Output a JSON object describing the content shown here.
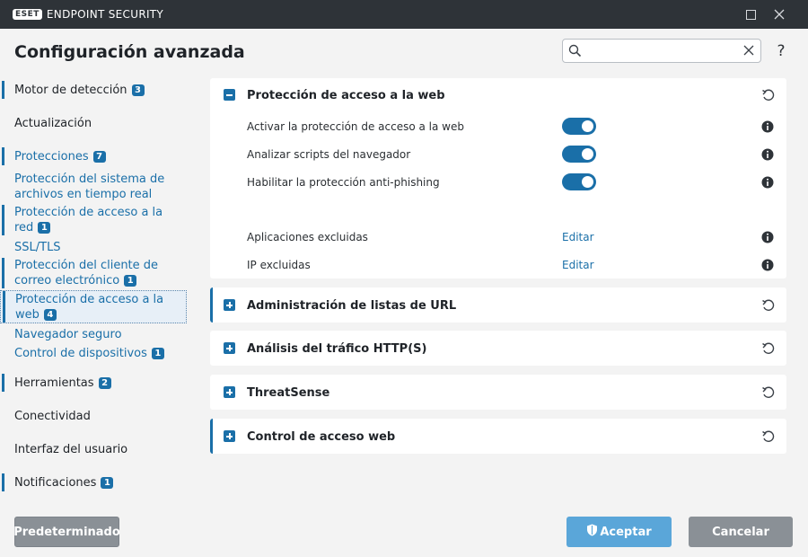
{
  "titlebar": {
    "logo": "ESET",
    "product": "ENDPOINT SECURITY",
    "minimize_icon": "minimize-icon",
    "maximize_icon": "maximize-icon",
    "close_icon": "close-icon"
  },
  "header": {
    "title": "Configuración avanzada",
    "search_value": "",
    "search_placeholder": "",
    "help": "?"
  },
  "sidebar": {
    "items": [
      {
        "label": "Motor de detección",
        "count": "3"
      },
      {
        "label": "Actualización"
      },
      {
        "label": "Protecciones",
        "count": "7"
      },
      {
        "label": "Protección del sistema de archivos en tiempo real"
      },
      {
        "label": "Protección de acceso a la red",
        "count": "1"
      },
      {
        "label": "SSL/TLS"
      },
      {
        "label": "Protección del cliente de correo electrónico",
        "count": "1"
      },
      {
        "label": "Protección de acceso a la web",
        "count": "4"
      },
      {
        "label": "Navegador seguro"
      },
      {
        "label": "Control de dispositivos",
        "count": "1"
      },
      {
        "label": "Herramientas",
        "count": "2"
      },
      {
        "label": "Conectividad"
      },
      {
        "label": "Interfaz del usuario"
      },
      {
        "label": "Notificaciones",
        "count": "1"
      }
    ]
  },
  "main": {
    "expanded": {
      "title": "Protección de acceso a la web",
      "settings": [
        {
          "label": "Activar la protección de acceso a la web",
          "enabled": true
        },
        {
          "label": "Analizar scripts del navegador",
          "enabled": true
        },
        {
          "label": "Habilitar la protección anti-phishing",
          "enabled": true
        },
        {
          "label": "Aplicaciones excluidas",
          "action": "Editar"
        },
        {
          "label": "IP excluidas",
          "action": "Editar"
        }
      ]
    },
    "collapsed": [
      {
        "title": "Administración de listas de URL"
      },
      {
        "title": "Análisis del tráfico HTTP(S)"
      },
      {
        "title": "ThreatSense"
      },
      {
        "title": "Control de acceso web"
      }
    ]
  },
  "footer": {
    "default_label": "Predeterminado",
    "accept_label": "Aceptar",
    "cancel_label": "Cancelar"
  },
  "colors": {
    "accent": "#1a6fa8",
    "titlebar": "#2e3338",
    "accept": "#5aa6d9",
    "neutral_button": "#8a9096"
  }
}
